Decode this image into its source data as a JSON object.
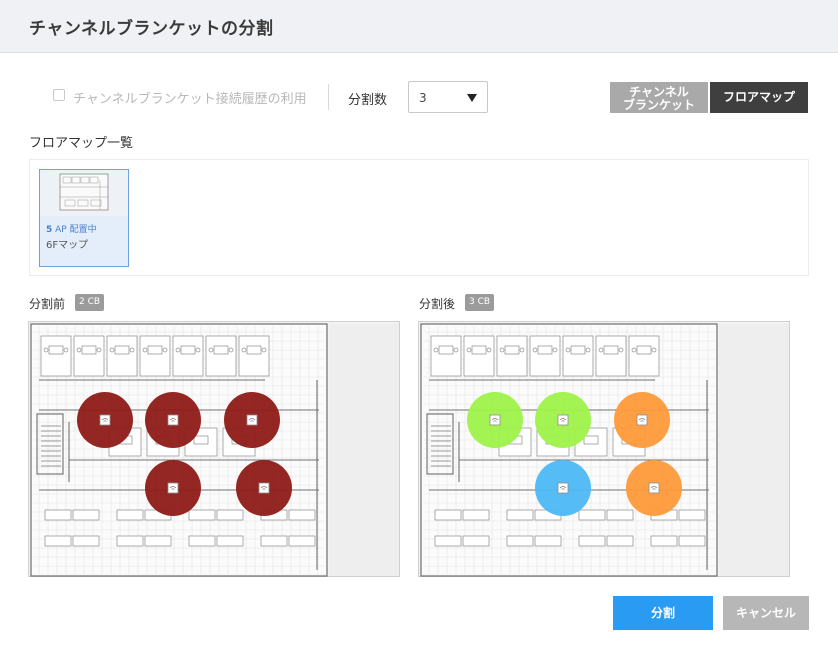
{
  "dialog": {
    "title": "チャンネルブランケットの分割"
  },
  "options": {
    "history_label": "チャンネルブランケット接続履歴の利用",
    "history_checked": false,
    "division_label": "分割数",
    "division_value": "3"
  },
  "view_toggle": {
    "cb_label": "チャンネル\nブランケット",
    "floormap_label": "フロアマップ",
    "active": "floormap"
  },
  "floormap_list": {
    "title": "フロアマップ一覧",
    "items": [
      {
        "ap_count": "5",
        "ap_status": "AP 配置中",
        "name": "6Fマップ"
      }
    ]
  },
  "before": {
    "label": "分割前",
    "badge": "2 CB",
    "aps": [
      {
        "color": "#8e1b17"
      },
      {
        "color": "#8e1b17"
      },
      {
        "color": "#8e1b17"
      },
      {
        "color": "#8e1b17"
      },
      {
        "color": "#8e1b17"
      }
    ]
  },
  "after": {
    "label": "分割後",
    "badge": "3 CB",
    "aps": [
      {
        "color": "#9ef24a"
      },
      {
        "color": "#9ef24a"
      },
      {
        "color": "#ff9a3a"
      },
      {
        "color": "#4db8f5"
      },
      {
        "color": "#ff9a3a"
      }
    ]
  },
  "footer": {
    "split_label": "分割",
    "cancel_label": "キャンセル"
  },
  "colors": {
    "primary": "#2a9bf3",
    "dark": "#3f3f3f",
    "disabled": "#b7b7b7"
  }
}
